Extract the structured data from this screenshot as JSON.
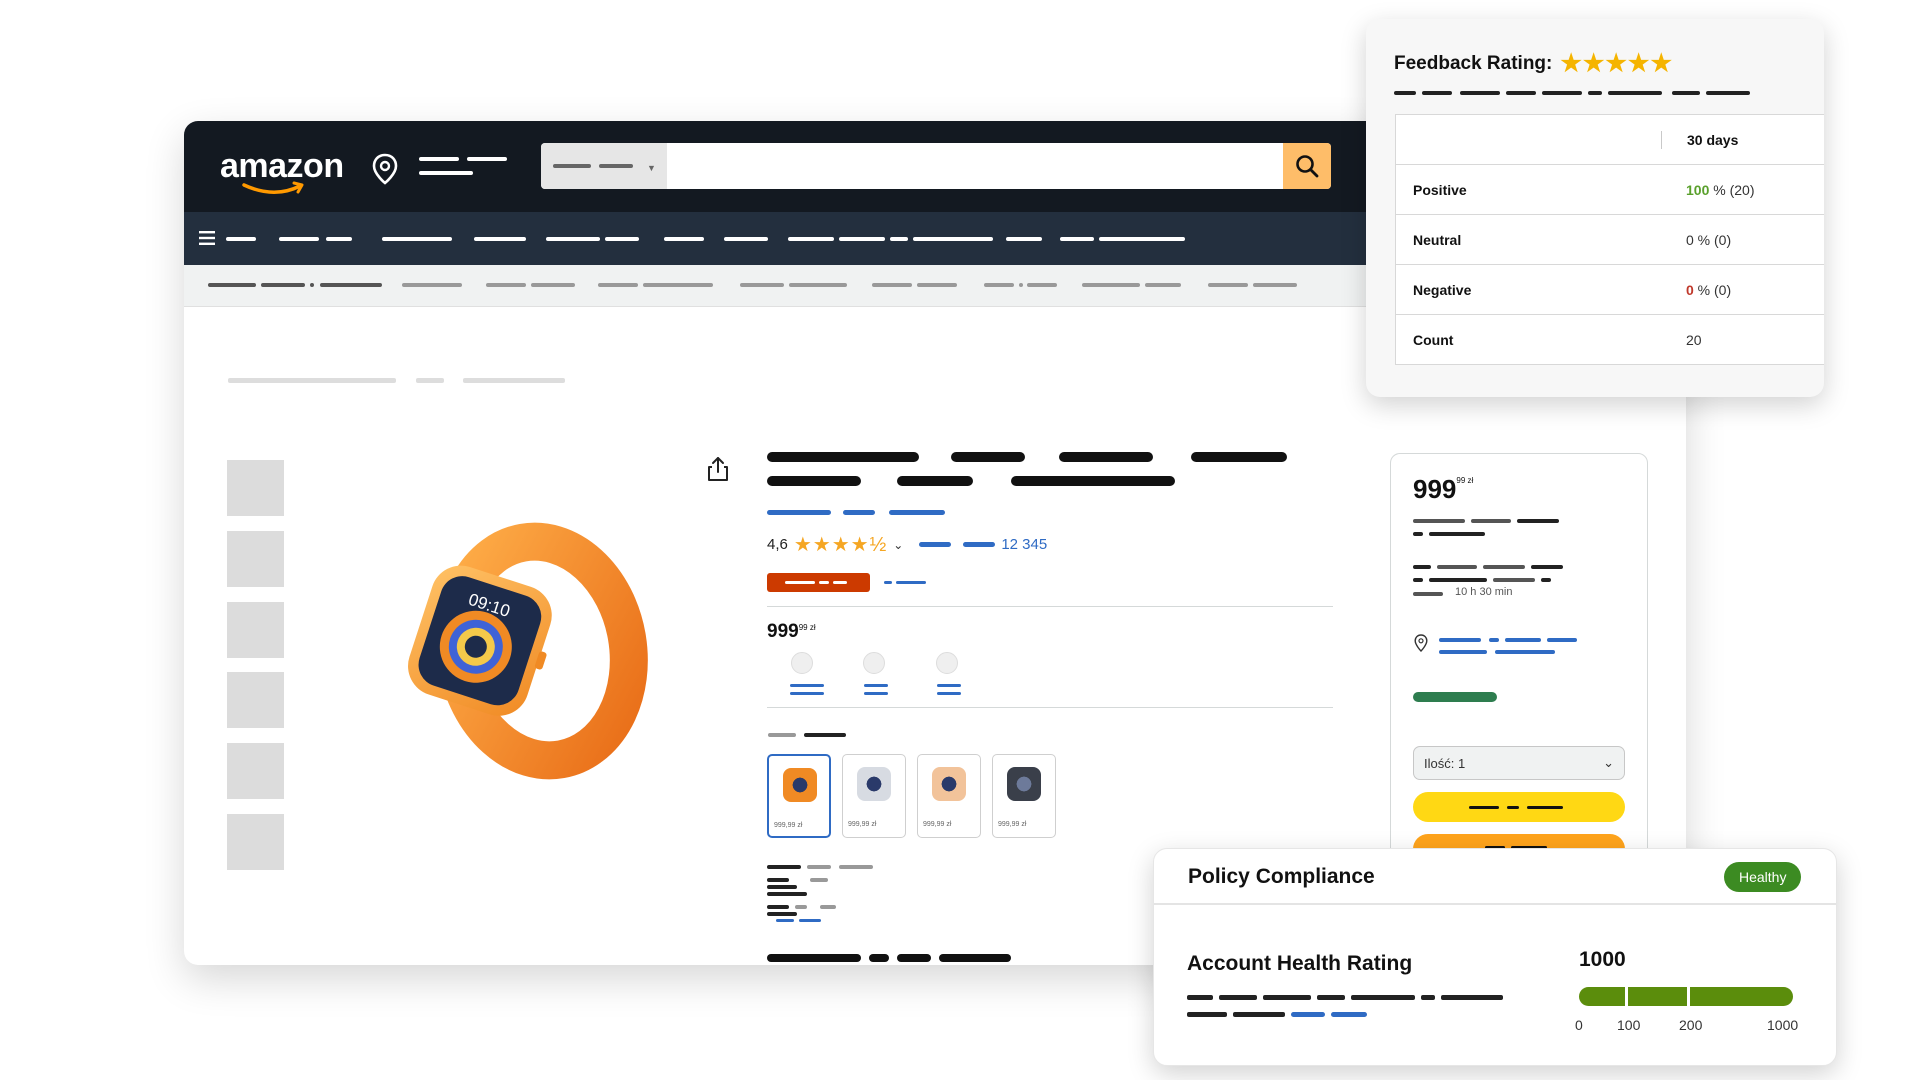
{
  "amazon": {
    "logo_text": "amazon",
    "search_placeholder": ""
  },
  "product": {
    "rating_value": "4,6",
    "stars": "★★★★½",
    "review_count": "12 345",
    "price_main": "999",
    "price_sup": "99 zł",
    "variants": [
      {
        "price": "999,99 zł",
        "color": "#f08a24"
      },
      {
        "price": "999,99 zł",
        "color": "#d7dbe2"
      },
      {
        "price": "999,99 zł",
        "color": "#f2c39a"
      },
      {
        "price": "999,99 zł",
        "color": "#3a3f4a"
      }
    ],
    "watch_time": "09:10"
  },
  "buybox": {
    "price_main": "999",
    "price_sup": "99 zł",
    "delivery_time": "10 h 30 min",
    "quantity_label": "Ilość: 1"
  },
  "feedback": {
    "title": "Feedback Rating:",
    "stars": "★★★★★",
    "period_header": "30 days",
    "rows": [
      {
        "label": "Positive",
        "pct": "100",
        "rest": " % (20)",
        "tone": "green"
      },
      {
        "label": "Neutral",
        "pct": "0",
        "rest": " % (0)",
        "tone": "none"
      },
      {
        "label": "Negative",
        "pct": "0",
        "rest": " % (0)",
        "tone": "red"
      },
      {
        "label": "Count",
        "pct": "20",
        "rest": "",
        "tone": "none"
      }
    ]
  },
  "policy": {
    "title": "Policy Compliance",
    "badge": "Healthy",
    "subtitle": "Account Health Rating",
    "score": "1000",
    "scale": [
      "0",
      "100",
      "200",
      "1000"
    ]
  },
  "colors": {
    "amazon_dark": "#131921",
    "amazon_nav": "#232f3e",
    "accent_orange": "#febd69",
    "link_blue": "#2f6bc4",
    "health_green": "#3c8b22",
    "meter_green": "#5b8d0c",
    "star_gold": "#f5b400"
  }
}
